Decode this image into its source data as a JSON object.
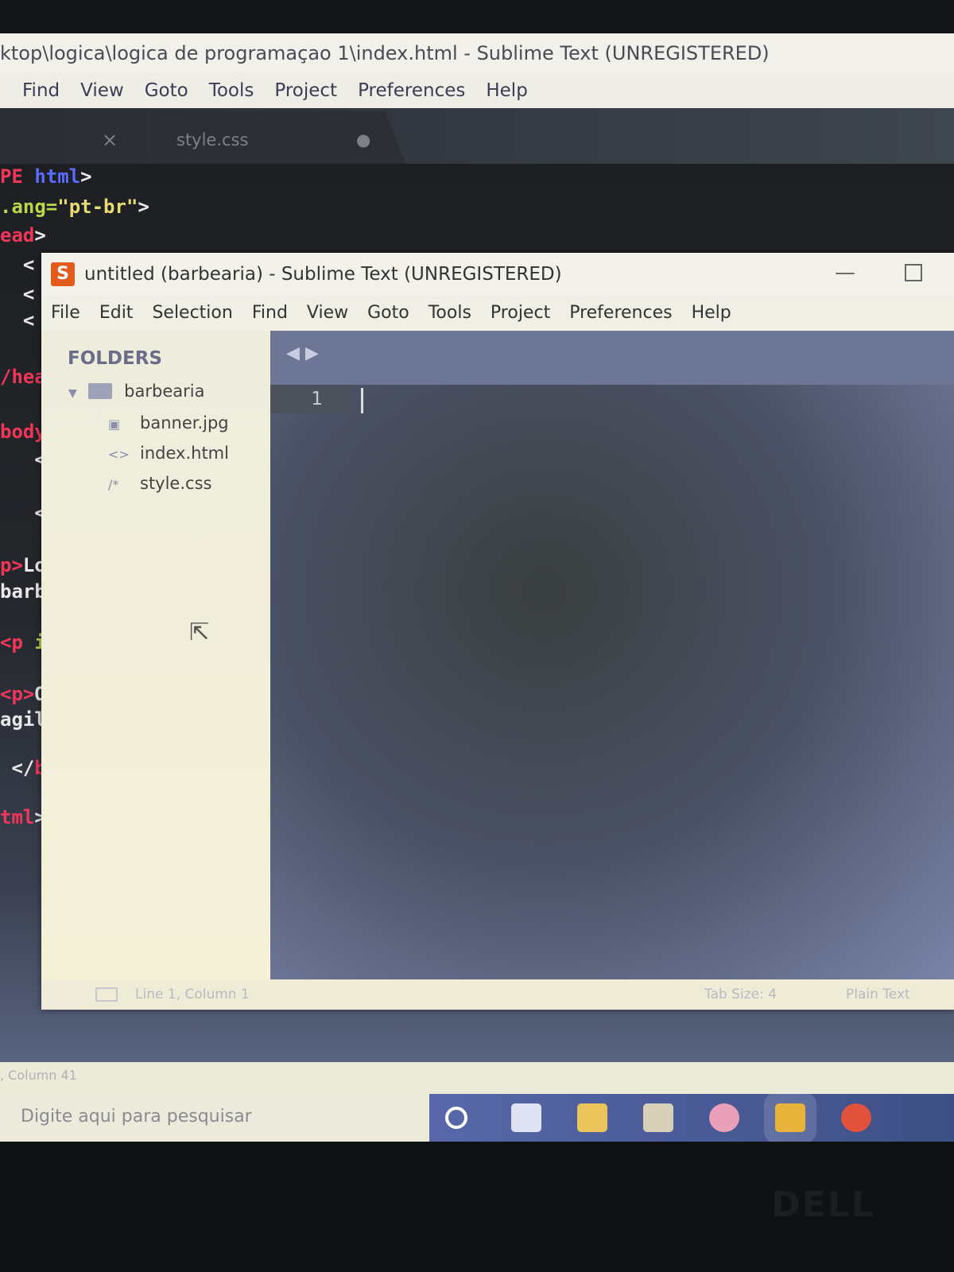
{
  "background_window": {
    "title": "ktop\\logica\\logica de programaçao 1\\index.html - Sublime Text (UNREGISTERED)",
    "menu": [
      "Find",
      "View",
      "Goto",
      "Tools",
      "Project",
      "Preferences",
      "Help"
    ],
    "tabs": [
      {
        "label": "",
        "close": "×"
      },
      {
        "label": "style.css",
        "modified": "●"
      }
    ],
    "code_lines": [
      [
        {
          "t": "PE ",
          "c": "#f0365a"
        },
        {
          "t": "html",
          "c": "#5a6cff"
        },
        {
          "t": ">",
          "c": "#e8e8e8"
        }
      ],
      [
        {
          "t": ".ang=",
          "c": "#b8d84a"
        },
        {
          "t": "\"pt-br\"",
          "c": "#e6db74"
        },
        {
          "t": ">",
          "c": "#e8e8e8"
        }
      ],
      [
        {
          "t": "ead",
          "c": "#f0365a"
        },
        {
          "t": ">",
          "c": "#e8e8e8"
        }
      ],
      [
        {
          "t": "  <",
          "c": "#e8e8e8"
        }
      ],
      [
        {
          "t": "  <",
          "c": "#e8e8e8"
        }
      ],
      [
        {
          "t": "  <",
          "c": "#e8e8e8"
        }
      ],
      [
        {
          "t": "/head",
          "c": "#f0365a"
        }
      ],
      [
        {
          "t": "body>",
          "c": "#f0365a"
        }
      ],
      [
        {
          "t": "   <",
          "c": "#e8e8e8"
        }
      ],
      [
        {
          "t": "   <",
          "c": "#e8e8e8"
        }
      ],
      [
        {
          "t": "p>",
          "c": "#f0365a"
        },
        {
          "t": "Lo",
          "c": "#e8e8e8"
        }
      ],
      [
        {
          "t": "barba",
          "c": "#e8e8e8"
        }
      ],
      [
        {
          "t": "<p ",
          "c": "#f0365a"
        },
        {
          "t": "id=",
          "c": "#b8d84a"
        }
      ],
      [
        {
          "t": "<p>",
          "c": "#f0365a"
        },
        {
          "t": "Of",
          "c": "#e8e8e8"
        }
      ],
      [
        {
          "t": "agili",
          "c": "#e8e8e8"
        }
      ],
      [
        {
          "t": " </",
          "c": "#e8e8e8"
        },
        {
          "t": "body",
          "c": "#f0365a"
        }
      ],
      [
        {
          "t": "tml",
          "c": "#f0365a"
        },
        {
          "t": ">",
          "c": "#e8e8e8"
        }
      ]
    ],
    "status": ", Column 41"
  },
  "window": {
    "title": "untitled (barbearia) - Sublime Text (UNREGISTERED)",
    "logo": "S",
    "minimize": "—",
    "menu": [
      "File",
      "Edit",
      "Selection",
      "Find",
      "View",
      "Goto",
      "Tools",
      "Project",
      "Preferences",
      "Help"
    ],
    "sidebar": {
      "header": "FOLDERS",
      "folder": "barbearia",
      "files": [
        {
          "name": "banner.jpg",
          "icon": "image-icon",
          "glyph": "▣"
        },
        {
          "name": "index.html",
          "icon": "code-icon",
          "glyph": "<>"
        },
        {
          "name": "style.css",
          "icon": "comment-icon",
          "glyph": "/*"
        }
      ]
    },
    "editor": {
      "nav_arrows": "◀ ▶",
      "line_number": "1"
    },
    "status": {
      "position": "Line 1, Column 1",
      "tab_size": "Tab Size: 4",
      "syntax": "Plain Text"
    }
  },
  "taskbar": {
    "search_placeholder": "Digite aqui para pesquisar",
    "icons": [
      {
        "name": "cortana-icon",
        "color": "#ffffff"
      },
      {
        "name": "task-view-icon",
        "color": "#dfe3f5"
      },
      {
        "name": "file-explorer-icon",
        "color": "#e8c45a"
      },
      {
        "name": "store-icon",
        "color": "#d7d0b8"
      },
      {
        "name": "itunes-icon",
        "color": "#e9a0b8"
      },
      {
        "name": "sublime-text-icon",
        "color": "#e8b33a"
      },
      {
        "name": "chrome-icon",
        "color": "#e0523c"
      }
    ]
  },
  "bezel": {
    "brand": "DELL"
  }
}
